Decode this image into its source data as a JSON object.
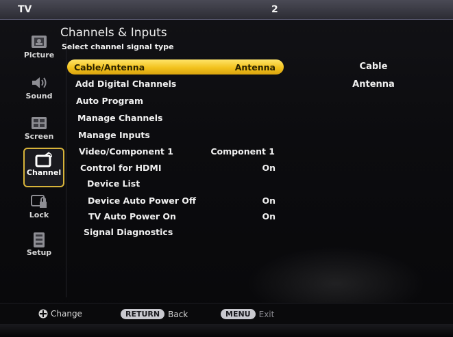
{
  "topbar": {
    "source": "TV",
    "channel": "2"
  },
  "sidebar": {
    "items": [
      {
        "label": "Picture",
        "icon": "picture-icon"
      },
      {
        "label": "Sound",
        "icon": "speaker-icon"
      },
      {
        "label": "Screen",
        "icon": "screen-icon"
      },
      {
        "label": "Channel",
        "icon": "channel-icon",
        "active": true
      },
      {
        "label": "Lock",
        "icon": "lock-icon"
      },
      {
        "label": "Setup",
        "icon": "setup-icon"
      }
    ]
  },
  "panel": {
    "title": "Channels & Inputs",
    "subtitle": "Select channel signal type"
  },
  "menu": {
    "items": [
      {
        "label": "Cable/Antenna",
        "value": "Antenna",
        "selected": true
      },
      {
        "label": "Add Digital Channels",
        "value": ""
      },
      {
        "label": "Auto Program",
        "value": ""
      },
      {
        "label": "Manage Channels",
        "value": ""
      },
      {
        "label": "Manage Inputs",
        "value": ""
      },
      {
        "label": "Video/Component 1",
        "value": "Component 1"
      },
      {
        "label": "Control for HDMI",
        "value": "On"
      },
      {
        "label": "Device List",
        "value": ""
      },
      {
        "label": "Device Auto Power Off",
        "value": "On"
      },
      {
        "label": "TV Auto Power On",
        "value": "On"
      },
      {
        "label": "Signal Diagnostics",
        "value": ""
      }
    ]
  },
  "options": [
    "Cable",
    "Antenna"
  ],
  "bottom": {
    "change": "Change",
    "return_key": "RETURN",
    "back": "Back",
    "menu_key": "MENU",
    "exit": "Exit"
  },
  "colors": {
    "highlight": "#f2c21d",
    "active_border": "#d8b43a"
  }
}
